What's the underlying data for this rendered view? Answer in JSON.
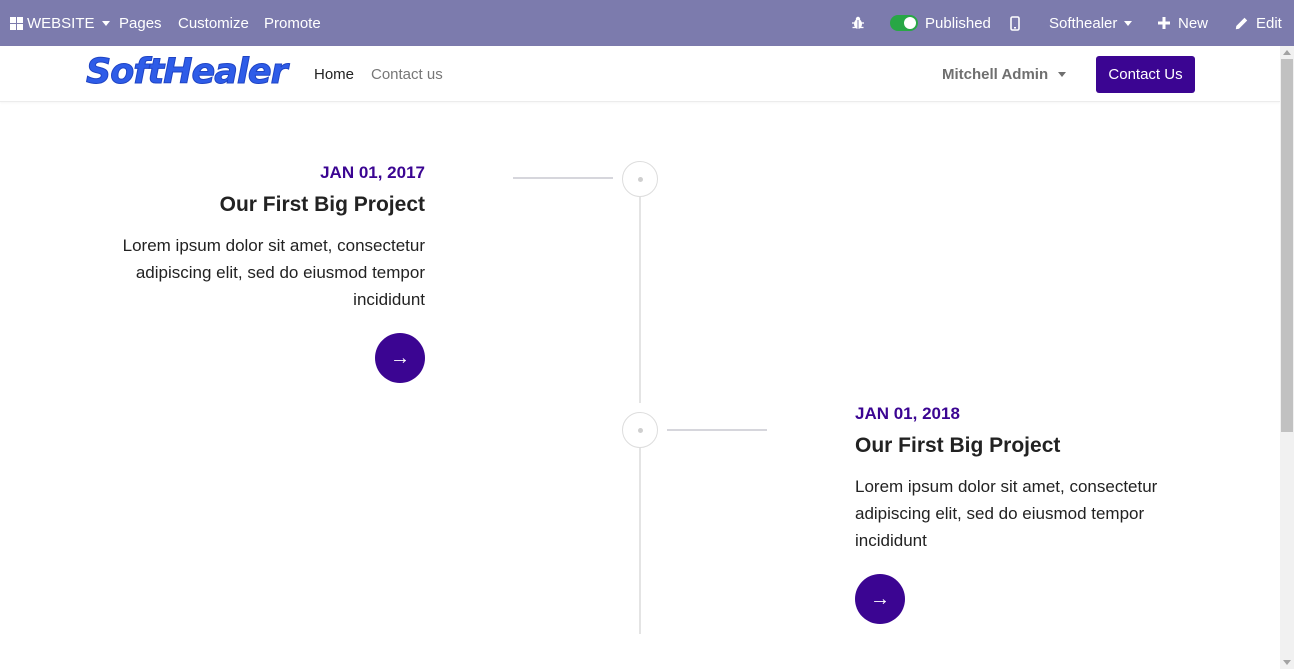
{
  "admin_bar": {
    "app_menu": "WEBSITE",
    "pages": "Pages",
    "customize": "Customize",
    "promote": "Promote",
    "published_label": "Published",
    "company": "Softhealer",
    "new_label": "New",
    "edit_label": "Edit"
  },
  "navbar": {
    "logo_text": "SoftHealer",
    "home": "Home",
    "contact_us_link": "Contact us",
    "user": "Mitchell Admin",
    "contact_button": "Contact Us"
  },
  "timeline": [
    {
      "date": "JAN 01, 2017",
      "title": "Our First Big Project",
      "text": "Lorem ipsum dolor sit amet, consectetur adipiscing elit, sed do eiusmod tempor incididunt",
      "button_icon": "→"
    },
    {
      "date": "JAN 01, 2018",
      "title": "Our First Big Project",
      "text": "Lorem ipsum dolor sit amet, consectetur adipiscing elit, sed do eiusmod tempor incididunt",
      "button_icon": "→"
    }
  ],
  "colors": {
    "admin_bar": "#7c7bad",
    "accent": "#3b0592",
    "logo": "#2e5ce8",
    "toggle_on": "#28a745"
  },
  "icons": [
    "apps-grid-icon",
    "bug-icon",
    "mobile-icon",
    "plus-icon",
    "pencil-icon",
    "arrow-right-icon"
  ]
}
